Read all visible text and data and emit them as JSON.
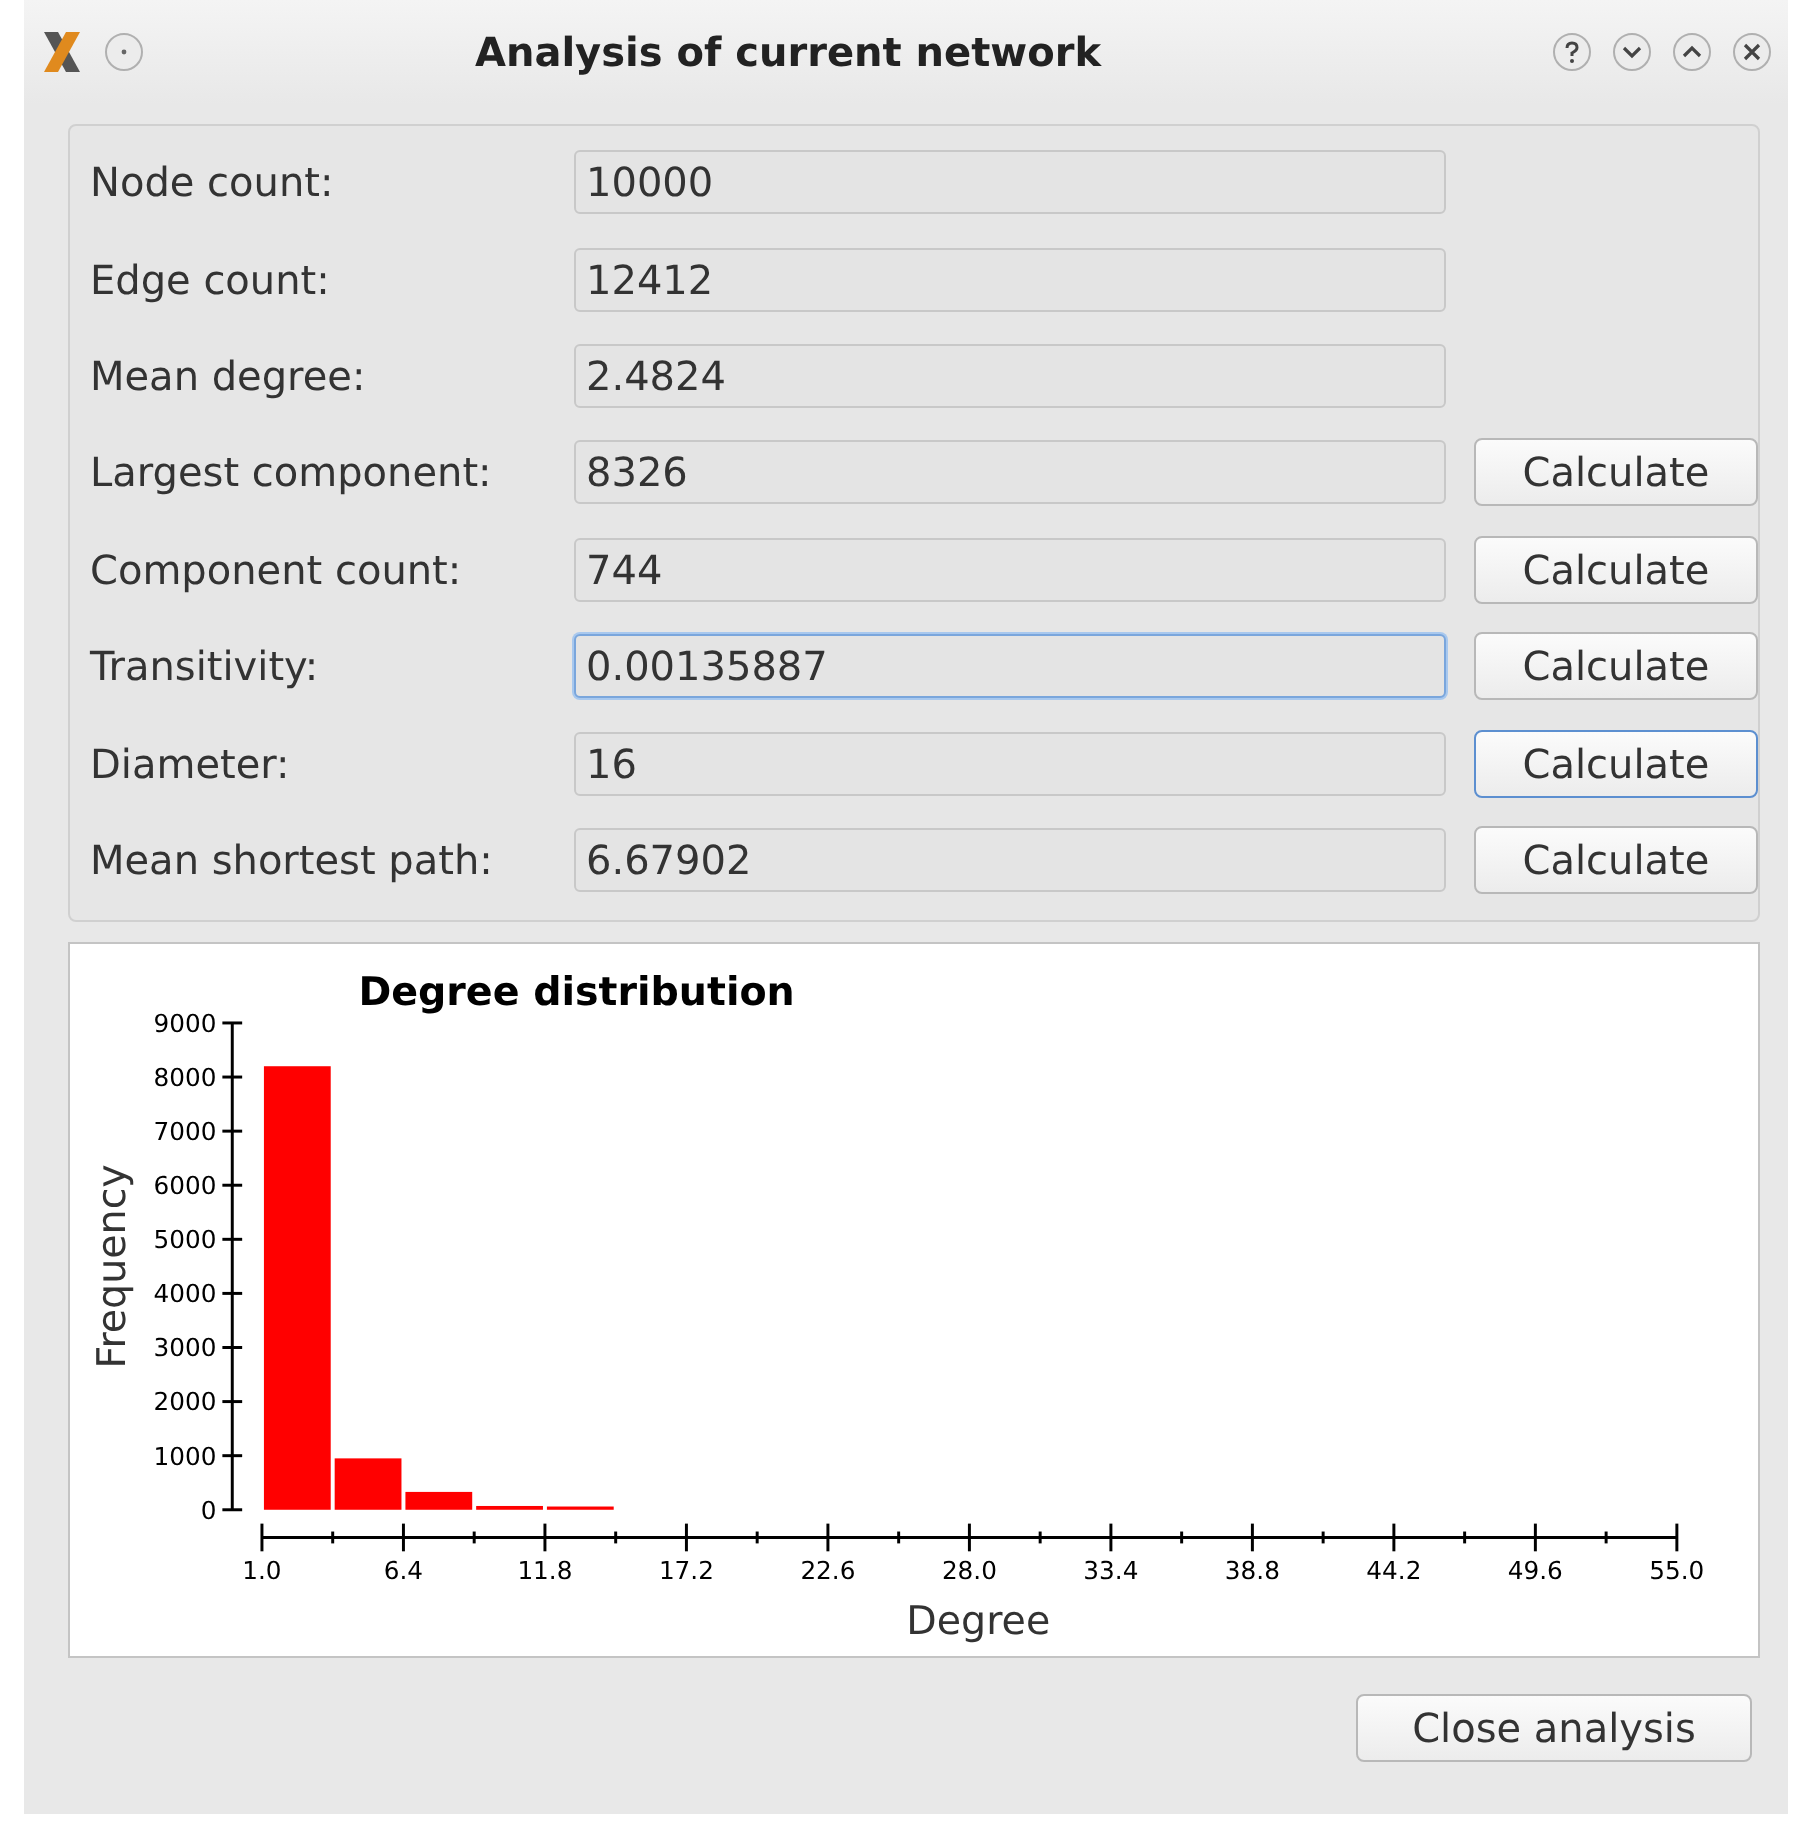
{
  "window": {
    "title": "Analysis of current network"
  },
  "stats": [
    {
      "label": "Node count:",
      "value": "10000",
      "focused": false
    },
    {
      "label": "Edge count:",
      "value": "12412",
      "focused": false
    },
    {
      "label": "Mean degree:",
      "value": "2.4824",
      "focused": false
    },
    {
      "label": "Largest component:",
      "value": "8326",
      "focused": false,
      "button": {
        "label": "Calculate",
        "focused": false
      }
    },
    {
      "label": "Component count:",
      "value": "744",
      "focused": false,
      "button": {
        "label": "Calculate",
        "focused": false
      }
    },
    {
      "label": "Transitivity:",
      "value": "0.00135887",
      "focused": true,
      "button": {
        "label": "Calculate",
        "focused": false
      }
    },
    {
      "label": "Diameter:",
      "value": "16",
      "focused": false,
      "button": {
        "label": "Calculate",
        "focused": true
      }
    },
    {
      "label": "Mean shortest path:",
      "value": "6.67902",
      "focused": false,
      "button": {
        "label": "Calculate",
        "focused": false
      }
    }
  ],
  "plot": {
    "chart_data": {
      "type": "bar",
      "title": "Degree distribution",
      "xlabel": "Degree",
      "ylabel": "Frequency",
      "x": [
        2.35,
        5.05,
        7.75,
        10.45,
        13.15
      ],
      "series": [
        {
          "color": "#ff0000",
          "values": [
            8200,
            950,
            330,
            70,
            60
          ]
        }
      ],
      "xlim": [
        1.0,
        55.0
      ],
      "ylim": [
        0,
        9000
      ],
      "xticks": [
        {
          "value": 1.0,
          "label": "1.0"
        },
        {
          "value": 6.4,
          "label": "6.4"
        },
        {
          "value": 11.8,
          "label": "11.8"
        },
        {
          "value": 17.2,
          "label": "17.2"
        },
        {
          "value": 22.6,
          "label": "22.6"
        },
        {
          "value": 28.0,
          "label": "28.0"
        },
        {
          "value": 33.4,
          "label": "33.4"
        },
        {
          "value": 38.8,
          "label": "38.8"
        },
        {
          "value": 44.2,
          "label": "44.2"
        },
        {
          "value": 49.6,
          "label": "49.6"
        },
        {
          "value": 55.0,
          "label": "55.0"
        }
      ],
      "yticks": [
        0,
        1000,
        2000,
        3000,
        4000,
        5000,
        6000,
        7000,
        8000,
        9000
      ]
    }
  },
  "close_button": {
    "label": "Close analysis"
  }
}
